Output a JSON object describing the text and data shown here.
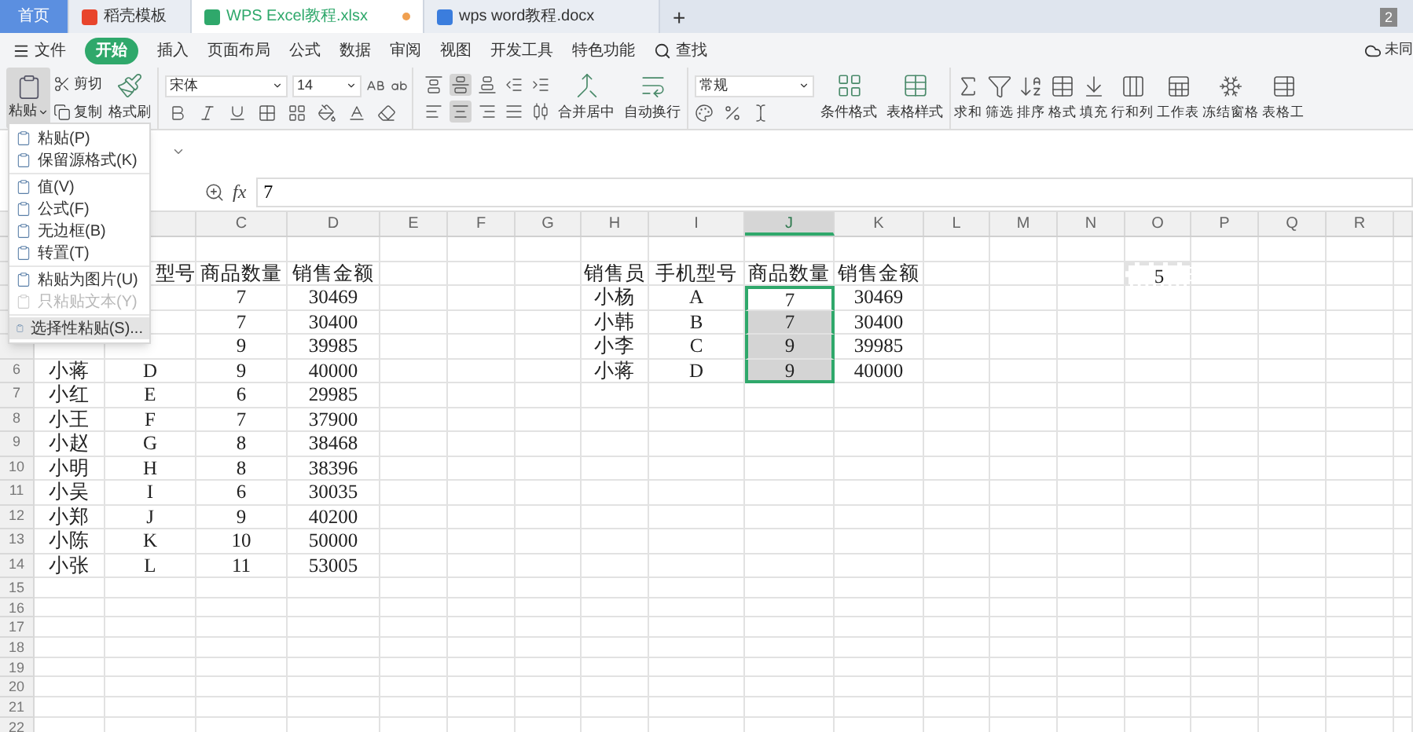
{
  "tabs": [
    {
      "label": "首页",
      "kind": "home",
      "selected": false
    },
    {
      "label": "稻壳模板",
      "kind": "docer",
      "selected": false
    },
    {
      "label": "WPS Excel教程.xlsx",
      "kind": "sheet",
      "selected": true
    },
    {
      "label": "wps word教程.docx",
      "kind": "doc",
      "selected": false
    }
  ],
  "new_tab": "+",
  "window_count": "2",
  "menu": [
    {
      "label": "文件",
      "kind": "file",
      "selected": false
    },
    {
      "label": "开始",
      "kind": "tab",
      "selected": true
    },
    {
      "label": "插入",
      "kind": "tab",
      "selected": false
    },
    {
      "label": "页面布局",
      "kind": "tab",
      "selected": false
    },
    {
      "label": "公式",
      "kind": "tab",
      "selected": false
    },
    {
      "label": "数据",
      "kind": "tab",
      "selected": false
    },
    {
      "label": "审阅",
      "kind": "tab",
      "selected": false
    },
    {
      "label": "视图",
      "kind": "tab",
      "selected": false
    },
    {
      "label": "开发工具",
      "kind": "tab",
      "selected": false
    },
    {
      "label": "特色功能",
      "kind": "tab",
      "selected": false
    },
    {
      "label": "查找",
      "kind": "search",
      "selected": false
    }
  ],
  "sync_status": "未同",
  "toolbar": {
    "paste": "粘贴",
    "paste_open": true,
    "cut": "剪切",
    "copy": "复制",
    "format_painter": "格式刷",
    "font": "宋体",
    "font_size": "14",
    "merge": "合并居中",
    "wrap": "自动换行",
    "number_format": "常规",
    "conditional": "条件格式",
    "table_style": "表格样式",
    "align_top": [
      {
        "kind": "top",
        "selected": false
      },
      {
        "kind": "middle",
        "selected": true
      },
      {
        "kind": "bottom",
        "selected": false
      },
      {
        "kind": "outdent",
        "selected": false
      },
      {
        "kind": "indent",
        "selected": false
      }
    ],
    "align_bottom": [
      {
        "kind": "left",
        "selected": false
      },
      {
        "kind": "center",
        "selected": true
      },
      {
        "kind": "right",
        "selected": false
      },
      {
        "kind": "justify",
        "selected": false
      },
      {
        "kind": "distributed",
        "selected": false
      }
    ],
    "tools": [
      {
        "label": "求和",
        "kind": "sum"
      },
      {
        "label": "筛选",
        "kind": "filter"
      },
      {
        "label": "排序",
        "kind": "sort"
      },
      {
        "label": "格式",
        "kind": "format"
      },
      {
        "label": "填充",
        "kind": "fill"
      },
      {
        "label": "行和列",
        "kind": "rows"
      },
      {
        "label": "工作表",
        "kind": "sheet"
      },
      {
        "label": "冻结窗格",
        "kind": "freeze"
      },
      {
        "label": "表格工",
        "kind": "table"
      }
    ]
  },
  "paste_menu": [
    [
      {
        "label": "粘贴(P)",
        "disabled": false,
        "selected": false
      },
      {
        "label": "保留源格式(K)",
        "disabled": false,
        "selected": false
      }
    ],
    [
      {
        "label": "值(V)",
        "disabled": false,
        "selected": false
      },
      {
        "label": "公式(F)",
        "disabled": false,
        "selected": false
      },
      {
        "label": "无边框(B)",
        "disabled": false,
        "selected": false
      },
      {
        "label": "转置(T)",
        "disabled": false,
        "selected": false
      }
    ],
    [
      {
        "label": "粘贴为图片(U)",
        "disabled": false,
        "selected": false
      },
      {
        "label": "只粘贴文本(Y)",
        "disabled": true,
        "selected": false
      }
    ],
    [
      {
        "label": "选择性粘贴(S)...",
        "disabled": false,
        "selected": true
      }
    ]
  ],
  "formula_bar": {
    "fx": "fx",
    "value": "7"
  },
  "sheet": {
    "column_headers": [
      {
        "label": "C",
        "selected": false
      },
      {
        "label": "D",
        "selected": false
      },
      {
        "label": "E",
        "selected": false
      },
      {
        "label": "F",
        "selected": false
      },
      {
        "label": "G",
        "selected": false
      },
      {
        "label": "H",
        "selected": false
      },
      {
        "label": "I",
        "selected": false
      },
      {
        "label": "J",
        "selected": true
      },
      {
        "label": "K",
        "selected": false
      },
      {
        "label": "L",
        "selected": false
      },
      {
        "label": "M",
        "selected": false
      },
      {
        "label": "N",
        "selected": false
      },
      {
        "label": "O",
        "selected": false
      },
      {
        "label": "P",
        "selected": false
      },
      {
        "label": "Q",
        "selected": false
      },
      {
        "label": "R",
        "selected": false
      }
    ],
    "row_numbers": [
      "6",
      "7",
      "8",
      "9",
      "10",
      "11",
      "12",
      "13",
      "14",
      "15",
      "16",
      "17",
      "18",
      "19",
      "20",
      "21",
      "22"
    ],
    "left_table": {
      "header_partial": "型号",
      "headers": [
        "商品数量",
        "销售金额"
      ],
      "rows": [
        {
          "quantity": "7",
          "amount": "30469"
        },
        {
          "quantity": "7",
          "amount": "30400"
        },
        {
          "quantity": "9",
          "amount": "39985"
        },
        {
          "salesperson": "小蒋",
          "model": "D",
          "quantity": "9",
          "amount": "40000"
        },
        {
          "salesperson": "小红",
          "model": "E",
          "quantity": "6",
          "amount": "29985"
        },
        {
          "salesperson": "小王",
          "model": "F",
          "quantity": "7",
          "amount": "37900"
        },
        {
          "salesperson": "小赵",
          "model": "G",
          "quantity": "8",
          "amount": "38468"
        },
        {
          "salesperson": "小明",
          "model": "H",
          "quantity": "8",
          "amount": "38396"
        },
        {
          "salesperson": "小吴",
          "model": "I",
          "quantity": "6",
          "amount": "30035"
        },
        {
          "salesperson": "小郑",
          "model": "J",
          "quantity": "9",
          "amount": "40200"
        },
        {
          "salesperson": "小陈",
          "model": "K",
          "quantity": "10",
          "amount": "50000"
        },
        {
          "salesperson": "小张",
          "model": "L",
          "quantity": "11",
          "amount": "53005"
        }
      ]
    },
    "right_table": {
      "headers": [
        "销售员",
        "手机型号",
        "商品数量",
        "销售金额"
      ],
      "rows": [
        {
          "salesperson": "小杨",
          "model": "A",
          "quantity": "7",
          "amount": "30469",
          "selected": true,
          "active": true
        },
        {
          "salesperson": "小韩",
          "model": "B",
          "quantity": "7",
          "amount": "30400",
          "selected": true,
          "active": false
        },
        {
          "salesperson": "小李",
          "model": "C",
          "quantity": "9",
          "amount": "39985",
          "selected": true,
          "active": false
        },
        {
          "salesperson": "小蒋",
          "model": "D",
          "quantity": "9",
          "amount": "40000",
          "selected": true,
          "active": false
        }
      ]
    },
    "copied_cell": {
      "text": "5",
      "copied": true
    }
  }
}
